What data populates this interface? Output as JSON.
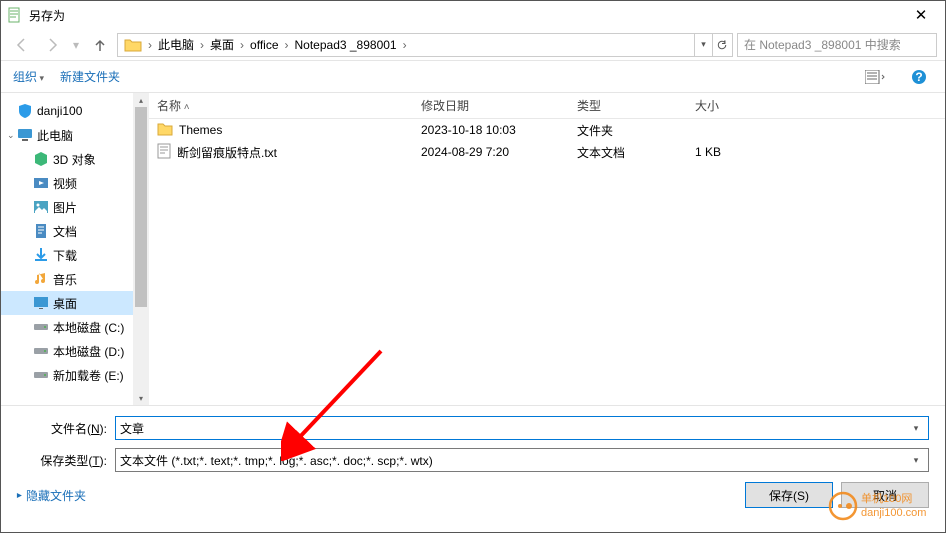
{
  "window": {
    "title": "另存为"
  },
  "breadcrumb": [
    "此电脑",
    "桌面",
    "office",
    "Notepad3 _898001"
  ],
  "search": {
    "placeholder": "在 Notepad3 _898001 中搜索"
  },
  "toolbar": {
    "organize": "组织",
    "newfolder": "新建文件夹"
  },
  "tree": [
    {
      "label": "danji100",
      "icon": "shield",
      "indent": false
    },
    {
      "label": "此电脑",
      "icon": "pc",
      "indent": false,
      "exp": "⌄"
    },
    {
      "label": "3D 对象",
      "icon": "cube",
      "indent": true
    },
    {
      "label": "视频",
      "icon": "video",
      "indent": true
    },
    {
      "label": "图片",
      "icon": "img",
      "indent": true
    },
    {
      "label": "文档",
      "icon": "doc",
      "indent": true
    },
    {
      "label": "下载",
      "icon": "dl",
      "indent": true
    },
    {
      "label": "音乐",
      "icon": "music",
      "indent": true
    },
    {
      "label": "桌面",
      "icon": "desk",
      "indent": true,
      "sel": true
    },
    {
      "label": "本地磁盘 (C:)",
      "icon": "disk",
      "indent": true
    },
    {
      "label": "本地磁盘 (D:)",
      "icon": "disk",
      "indent": true
    },
    {
      "label": "新加载卷 (E:)",
      "icon": "disk",
      "indent": true
    }
  ],
  "columns": {
    "name": "名称",
    "date": "修改日期",
    "type": "类型",
    "size": "大小"
  },
  "files": [
    {
      "name": "Themes",
      "date": "2023-10-18 10:03",
      "type": "文件夹",
      "size": "",
      "icon": "folder"
    },
    {
      "name": "断剑留痕版特点.txt",
      "date": "2024-08-29 7:20",
      "type": "文本文档",
      "size": "1 KB",
      "icon": "txt"
    }
  ],
  "form": {
    "filename_label": "文件名(N):",
    "filename_value": "文章",
    "filetype_label": "保存类型(T):",
    "filetype_value": "文本文件 (*.txt;*. text;*. tmp;*. log;*. asc;*. doc;*. scp;*. wtx)"
  },
  "footer": {
    "hide": "隐藏文件夹",
    "save": "保存(S)",
    "cancel": "取消"
  },
  "watermark": {
    "top": "单机100网",
    "bottom": "danji100.com"
  }
}
